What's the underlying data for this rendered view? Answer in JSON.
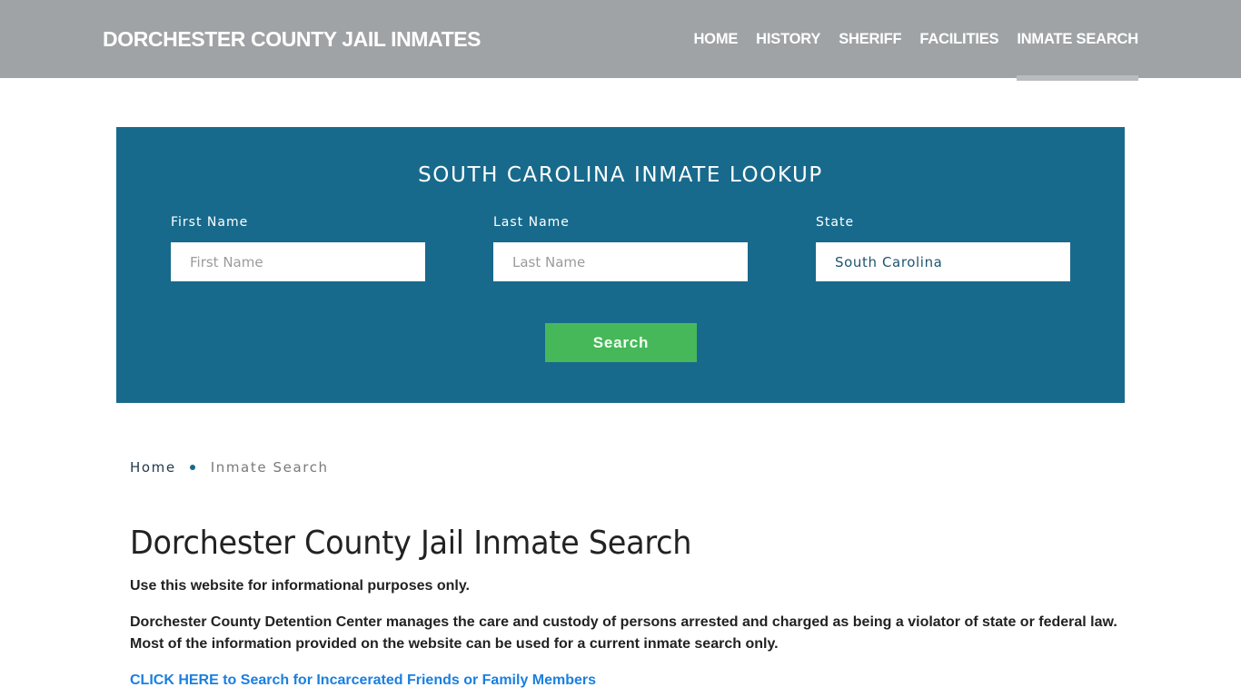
{
  "header": {
    "brand": "DORCHESTER COUNTY JAIL INMATES",
    "nav": [
      {
        "label": "HOME",
        "active": false
      },
      {
        "label": "HISTORY",
        "active": false
      },
      {
        "label": "SHERIFF",
        "active": false
      },
      {
        "label": "FACILITIES",
        "active": false
      },
      {
        "label": "INMATE SEARCH",
        "active": true
      }
    ]
  },
  "lookup": {
    "title": "SOUTH CAROLINA INMATE LOOKUP",
    "first_name": {
      "label": "First Name",
      "placeholder": "First Name",
      "value": ""
    },
    "last_name": {
      "label": "Last Name",
      "placeholder": "Last Name",
      "value": ""
    },
    "state": {
      "label": "State",
      "value": "South Carolina"
    },
    "search_label": "Search"
  },
  "breadcrumb": {
    "home": "Home",
    "current": "Inmate Search"
  },
  "content": {
    "title": "Dorchester County Jail Inmate Search",
    "paragraph1": "Use this website for informational purposes only.",
    "paragraph2": "Dorchester County Detention Center manages the care and custody of persons arrested and charged as being a violator of state or federal law. Most of the information provided on the website can be used for a current inmate search only.",
    "cta_link": "CLICK HERE to Search for Incarcerated Friends or Family Members"
  },
  "colors": {
    "header_bg": "#9fa3a6",
    "panel_bg": "#186a8c",
    "button_bg": "#46b85a",
    "link": "#1a7fe0"
  }
}
